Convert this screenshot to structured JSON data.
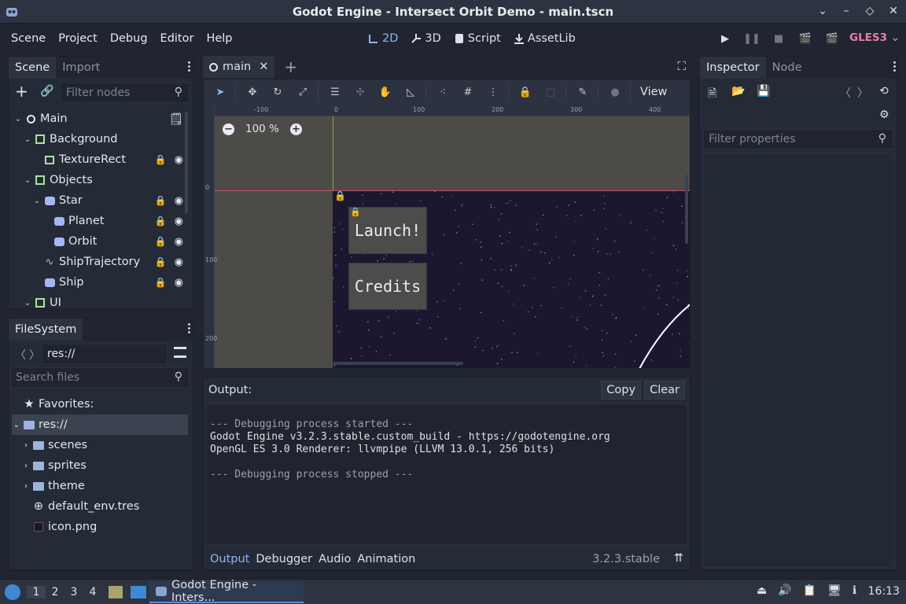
{
  "window": {
    "title": "Godot Engine - Intersect Orbit Demo - main.tscn"
  },
  "menu": [
    "Scene",
    "Project",
    "Debug",
    "Editor",
    "Help"
  ],
  "modes": [
    {
      "label": "2D",
      "active": true
    },
    {
      "label": "3D",
      "active": false
    },
    {
      "label": "Script",
      "active": false
    },
    {
      "label": "AssetLib",
      "active": false
    }
  ],
  "renderer": "GLES3",
  "scene_dock": {
    "tabs": [
      "Scene",
      "Import"
    ],
    "filter_placeholder": "Filter nodes",
    "nodes": [
      {
        "name": "Main",
        "depth": 0,
        "icon": "node2d-icon",
        "arrow": "v",
        "lock": false,
        "eye": false,
        "script": true
      },
      {
        "name": "Background",
        "depth": 1,
        "icon": "control-icon",
        "arrow": "v",
        "lock": false,
        "eye": false
      },
      {
        "name": "TextureRect",
        "depth": 2,
        "icon": "texture-rect-icon",
        "arrow": "",
        "lock": true,
        "eye": true
      },
      {
        "name": "Objects",
        "depth": 1,
        "icon": "control-icon",
        "arrow": "v",
        "lock": false,
        "eye": false
      },
      {
        "name": "Star",
        "depth": 2,
        "icon": "godot-sprite-icon",
        "arrow": "v",
        "lock": true,
        "eye": true
      },
      {
        "name": "Planet",
        "depth": 3,
        "icon": "godot-sprite-icon",
        "arrow": "",
        "lock": true,
        "eye": true
      },
      {
        "name": "Orbit",
        "depth": 3,
        "icon": "godot-sprite-icon",
        "arrow": "",
        "lock": true,
        "eye": true
      },
      {
        "name": "ShipTrajectory",
        "depth": 2,
        "icon": "line2d-icon",
        "arrow": "",
        "lock": true,
        "eye": true
      },
      {
        "name": "Ship",
        "depth": 2,
        "icon": "godot-sprite-icon",
        "arrow": "",
        "lock": true,
        "eye": true
      },
      {
        "name": "UI",
        "depth": 1,
        "icon": "control-icon",
        "arrow": "v",
        "lock": false,
        "eye": false
      }
    ]
  },
  "filesystem": {
    "tab": "FileSystem",
    "path": "res://",
    "search_placeholder": "Search files",
    "items": [
      {
        "name": "Favorites:",
        "depth": 0,
        "icon": "star-icon",
        "arrow": ""
      },
      {
        "name": "res://",
        "depth": 0,
        "icon": "folder-icon",
        "arrow": "v",
        "selected": true
      },
      {
        "name": "scenes",
        "depth": 1,
        "icon": "folder-icon",
        "arrow": ">"
      },
      {
        "name": "sprites",
        "depth": 1,
        "icon": "folder-icon",
        "arrow": ">"
      },
      {
        "name": "theme",
        "depth": 1,
        "icon": "folder-icon",
        "arrow": ">"
      },
      {
        "name": "default_env.tres",
        "depth": 1,
        "icon": "environment-icon",
        "arrow": ""
      },
      {
        "name": "icon.png",
        "depth": 1,
        "icon": "image-icon",
        "arrow": ""
      }
    ]
  },
  "editor": {
    "tab_name": "main",
    "view_label": "View",
    "zoom": "100 %",
    "ruler_h": [
      "-100",
      "0",
      "100",
      "200",
      "300",
      "400"
    ],
    "ruler_v": [
      "0",
      "100",
      "200"
    ],
    "buttons": [
      "Launch!",
      "Credits"
    ]
  },
  "output": {
    "title": "Output:",
    "copy": "Copy",
    "clear": "Clear",
    "lines": [
      {
        "text": "--- Debugging process started ---",
        "dim": true
      },
      {
        "text": "Godot Engine v3.2.3.stable.custom_build - https://godotengine.org",
        "dim": false
      },
      {
        "text": "OpenGL ES 3.0 Renderer: llvmpipe (LLVM 13.0.1, 256 bits)",
        "dim": false
      },
      {
        "text": "",
        "dim": false
      },
      {
        "text": "--- Debugging process stopped ---",
        "dim": true
      }
    ],
    "tabs": [
      "Output",
      "Debugger",
      "Audio",
      "Animation"
    ],
    "version": "3.2.3.stable"
  },
  "inspector": {
    "tabs": [
      "Inspector",
      "Node"
    ],
    "filter_placeholder": "Filter properties"
  },
  "taskbar": {
    "workspaces": [
      "1",
      "2",
      "3",
      "4"
    ],
    "task": "Godot Engine - Inters...",
    "clock": "16:13"
  }
}
